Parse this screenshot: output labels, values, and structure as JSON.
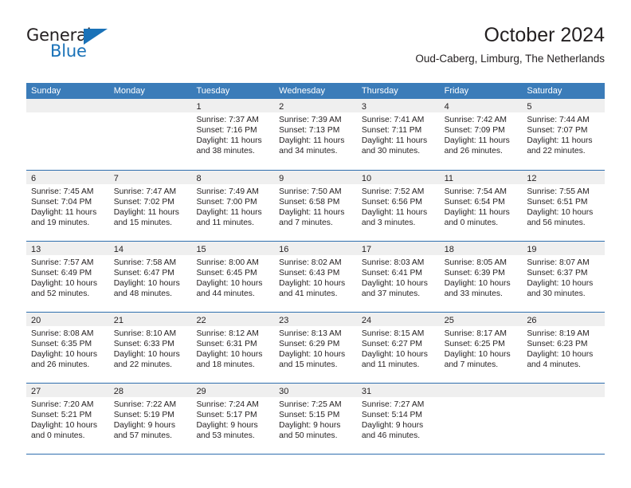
{
  "logo": {
    "word_top": "General",
    "word_bottom": "Blue",
    "triangle_color": "#1a72b8"
  },
  "header": {
    "title": "October 2024",
    "subtitle": "Oud-Caberg, Limburg, The Netherlands"
  },
  "colors": {
    "header_blue": "#3b7cb9",
    "rule_blue": "#2f6fae",
    "day_band_gray": "#efefef",
    "text": "#231f20"
  },
  "weekdays": [
    "Sunday",
    "Monday",
    "Tuesday",
    "Wednesday",
    "Thursday",
    "Friday",
    "Saturday"
  ],
  "weeks": [
    [
      {
        "day": "",
        "lines": []
      },
      {
        "day": "",
        "lines": []
      },
      {
        "day": "1",
        "lines": [
          "Sunrise: 7:37 AM",
          "Sunset: 7:16 PM",
          "Daylight: 11 hours",
          "and 38 minutes."
        ]
      },
      {
        "day": "2",
        "lines": [
          "Sunrise: 7:39 AM",
          "Sunset: 7:13 PM",
          "Daylight: 11 hours",
          "and 34 minutes."
        ]
      },
      {
        "day": "3",
        "lines": [
          "Sunrise: 7:41 AM",
          "Sunset: 7:11 PM",
          "Daylight: 11 hours",
          "and 30 minutes."
        ]
      },
      {
        "day": "4",
        "lines": [
          "Sunrise: 7:42 AM",
          "Sunset: 7:09 PM",
          "Daylight: 11 hours",
          "and 26 minutes."
        ]
      },
      {
        "day": "5",
        "lines": [
          "Sunrise: 7:44 AM",
          "Sunset: 7:07 PM",
          "Daylight: 11 hours",
          "and 22 minutes."
        ]
      }
    ],
    [
      {
        "day": "6",
        "lines": [
          "Sunrise: 7:45 AM",
          "Sunset: 7:04 PM",
          "Daylight: 11 hours",
          "and 19 minutes."
        ]
      },
      {
        "day": "7",
        "lines": [
          "Sunrise: 7:47 AM",
          "Sunset: 7:02 PM",
          "Daylight: 11 hours",
          "and 15 minutes."
        ]
      },
      {
        "day": "8",
        "lines": [
          "Sunrise: 7:49 AM",
          "Sunset: 7:00 PM",
          "Daylight: 11 hours",
          "and 11 minutes."
        ]
      },
      {
        "day": "9",
        "lines": [
          "Sunrise: 7:50 AM",
          "Sunset: 6:58 PM",
          "Daylight: 11 hours",
          "and 7 minutes."
        ]
      },
      {
        "day": "10",
        "lines": [
          "Sunrise: 7:52 AM",
          "Sunset: 6:56 PM",
          "Daylight: 11 hours",
          "and 3 minutes."
        ]
      },
      {
        "day": "11",
        "lines": [
          "Sunrise: 7:54 AM",
          "Sunset: 6:54 PM",
          "Daylight: 11 hours",
          "and 0 minutes."
        ]
      },
      {
        "day": "12",
        "lines": [
          "Sunrise: 7:55 AM",
          "Sunset: 6:51 PM",
          "Daylight: 10 hours",
          "and 56 minutes."
        ]
      }
    ],
    [
      {
        "day": "13",
        "lines": [
          "Sunrise: 7:57 AM",
          "Sunset: 6:49 PM",
          "Daylight: 10 hours",
          "and 52 minutes."
        ]
      },
      {
        "day": "14",
        "lines": [
          "Sunrise: 7:58 AM",
          "Sunset: 6:47 PM",
          "Daylight: 10 hours",
          "and 48 minutes."
        ]
      },
      {
        "day": "15",
        "lines": [
          "Sunrise: 8:00 AM",
          "Sunset: 6:45 PM",
          "Daylight: 10 hours",
          "and 44 minutes."
        ]
      },
      {
        "day": "16",
        "lines": [
          "Sunrise: 8:02 AM",
          "Sunset: 6:43 PM",
          "Daylight: 10 hours",
          "and 41 minutes."
        ]
      },
      {
        "day": "17",
        "lines": [
          "Sunrise: 8:03 AM",
          "Sunset: 6:41 PM",
          "Daylight: 10 hours",
          "and 37 minutes."
        ]
      },
      {
        "day": "18",
        "lines": [
          "Sunrise: 8:05 AM",
          "Sunset: 6:39 PM",
          "Daylight: 10 hours",
          "and 33 minutes."
        ]
      },
      {
        "day": "19",
        "lines": [
          "Sunrise: 8:07 AM",
          "Sunset: 6:37 PM",
          "Daylight: 10 hours",
          "and 30 minutes."
        ]
      }
    ],
    [
      {
        "day": "20",
        "lines": [
          "Sunrise: 8:08 AM",
          "Sunset: 6:35 PM",
          "Daylight: 10 hours",
          "and 26 minutes."
        ]
      },
      {
        "day": "21",
        "lines": [
          "Sunrise: 8:10 AM",
          "Sunset: 6:33 PM",
          "Daylight: 10 hours",
          "and 22 minutes."
        ]
      },
      {
        "day": "22",
        "lines": [
          "Sunrise: 8:12 AM",
          "Sunset: 6:31 PM",
          "Daylight: 10 hours",
          "and 18 minutes."
        ]
      },
      {
        "day": "23",
        "lines": [
          "Sunrise: 8:13 AM",
          "Sunset: 6:29 PM",
          "Daylight: 10 hours",
          "and 15 minutes."
        ]
      },
      {
        "day": "24",
        "lines": [
          "Sunrise: 8:15 AM",
          "Sunset: 6:27 PM",
          "Daylight: 10 hours",
          "and 11 minutes."
        ]
      },
      {
        "day": "25",
        "lines": [
          "Sunrise: 8:17 AM",
          "Sunset: 6:25 PM",
          "Daylight: 10 hours",
          "and 7 minutes."
        ]
      },
      {
        "day": "26",
        "lines": [
          "Sunrise: 8:19 AM",
          "Sunset: 6:23 PM",
          "Daylight: 10 hours",
          "and 4 minutes."
        ]
      }
    ],
    [
      {
        "day": "27",
        "lines": [
          "Sunrise: 7:20 AM",
          "Sunset: 5:21 PM",
          "Daylight: 10 hours",
          "and 0 minutes."
        ]
      },
      {
        "day": "28",
        "lines": [
          "Sunrise: 7:22 AM",
          "Sunset: 5:19 PM",
          "Daylight: 9 hours",
          "and 57 minutes."
        ]
      },
      {
        "day": "29",
        "lines": [
          "Sunrise: 7:24 AM",
          "Sunset: 5:17 PM",
          "Daylight: 9 hours",
          "and 53 minutes."
        ]
      },
      {
        "day": "30",
        "lines": [
          "Sunrise: 7:25 AM",
          "Sunset: 5:15 PM",
          "Daylight: 9 hours",
          "and 50 minutes."
        ]
      },
      {
        "day": "31",
        "lines": [
          "Sunrise: 7:27 AM",
          "Sunset: 5:14 PM",
          "Daylight: 9 hours",
          "and 46 minutes."
        ]
      },
      {
        "day": "",
        "lines": []
      },
      {
        "day": "",
        "lines": []
      }
    ]
  ]
}
